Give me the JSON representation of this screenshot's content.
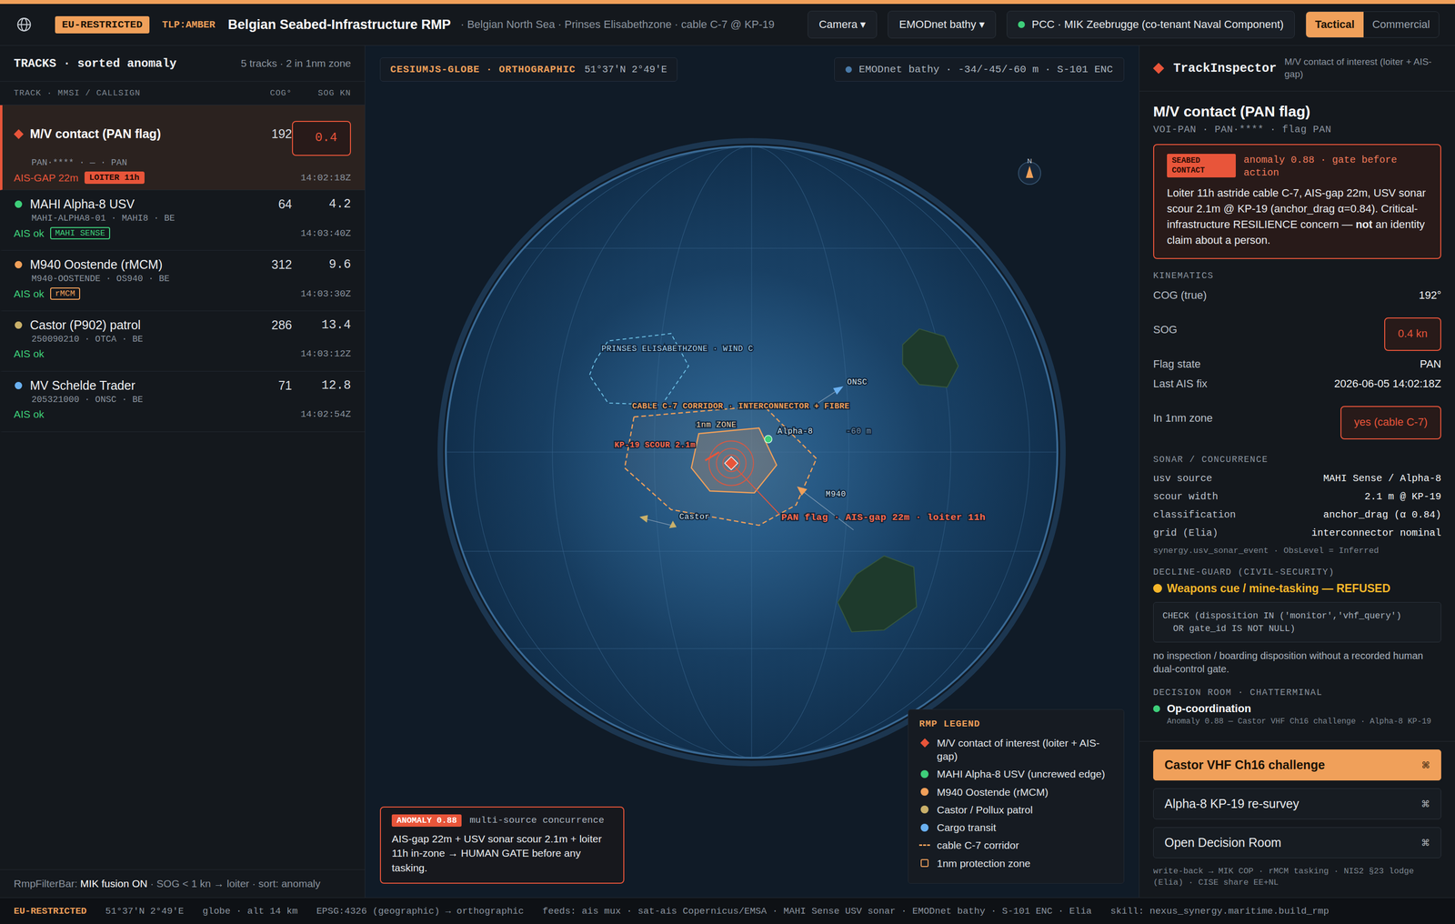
{
  "header": {
    "badge": "EU-RESTRICTED",
    "tlp": "TLP:AMBER",
    "title": "Belgian Seabed-Infrastructure RMP",
    "subtitle": "· Belgian North Sea · Prinses Elisabethzone · cable C-7 @ KP-19",
    "dropdowns": [
      "Camera ▾",
      "EMODnet bathy ▾"
    ],
    "pcc": "PCC · MIK Zeebrugge (co-tenant Naval Component)",
    "modes": [
      {
        "label": "Tactical",
        "selected": true
      },
      {
        "label": "Commercial",
        "selected": false
      }
    ]
  },
  "tracks_panel": {
    "title": "TRACKS · sorted anomaly",
    "count": "5 tracks · 2 in 1nm zone",
    "columns": [
      "TRACK · MMSI / CALLSIGN",
      "COG°",
      "SOG KN"
    ],
    "rows": [
      {
        "name": "M/V contact (PAN flag)",
        "ids": "PAN·**** · — · PAN",
        "cog": "192",
        "sog": "0.4",
        "sog_alert": true,
        "status": "AIS-GAP 22m",
        "status_color": "#e8553a",
        "tag": {
          "label": "LOITER 11h",
          "color": "#e8553a",
          "kind": "solid"
        },
        "time": "14:02:18Z",
        "color": "#e8553a",
        "kind": "diamond",
        "selected": true
      },
      {
        "name": "MAHI Alpha-8 USV",
        "ids": "MAHI-ALPHA8-01 · MAHI8 · BE",
        "cog": "64",
        "sog": "4.2",
        "sog_alert": false,
        "status": "AIS ok",
        "status_color": "#3ecf7a",
        "tag": {
          "label": "MAHI SENSE",
          "color": "#3ecf7a",
          "kind": "outline"
        },
        "time": "14:03:40Z",
        "color": "#3ecf7a",
        "kind": "dot",
        "selected": false
      },
      {
        "name": "M940 Oostende (rMCM)",
        "ids": "M940-OOSTENDE · OS940 · BE",
        "cog": "312",
        "sog": "9.6",
        "sog_alert": false,
        "status": "AIS ok",
        "status_color": "#3ecf7a",
        "tag": {
          "label": "rMCM",
          "color": "#f0a05a",
          "kind": "outline"
        },
        "time": "14:03:30Z",
        "color": "#f0a05a",
        "kind": "dot",
        "selected": false
      },
      {
        "name": "Castor (P902) patrol",
        "ids": "250090210 · OTCA · BE",
        "cog": "286",
        "sog": "13.4",
        "sog_alert": false,
        "status": "AIS ok",
        "status_color": "#3ecf7a",
        "tag": null,
        "time": "14:03:12Z",
        "color": "#c9b06a",
        "kind": "dot",
        "selected": false
      },
      {
        "name": "MV Schelde Trader",
        "ids": "205321000 · ONSC · BE",
        "cog": "71",
        "sog": "12.8",
        "sog_alert": false,
        "status": "AIS ok",
        "status_color": "#3ecf7a",
        "tag": null,
        "time": "14:02:54Z",
        "color": "#6ab0f0",
        "kind": "dot",
        "selected": false
      }
    ],
    "filter": {
      "prefix": "RmpFilterBar:",
      "highlight": "MIK fusion ON",
      "suffix": "· SOG < 1 kn → loiter · sort: anomaly"
    }
  },
  "map": {
    "projection": "CESIUMJS-GLOBE · ORTHOGRAPHIC",
    "coords": "51°37′N 2°49′E",
    "layers": "EMODnet bathy · -34/-45/-60 m · S-101 ENC",
    "compass": "N",
    "labels": [
      "PRINSES ELISABETHZONE · WIND C",
      "CABLE C-7 CORRIDOR · INTERCONNECTOR + FIBRE",
      "1nm ZONE",
      "KP-19 SCOUR 2.1m",
      "Alpha-8",
      "-60 m",
      "ONSC",
      "M940",
      "Castor",
      "PAN flag · AIS-gap 22m · loiter 11h"
    ],
    "anomaly": {
      "badge": "ANOMALY 0.88",
      "title": "multi-source concurrence",
      "text": "AIS-gap 22m + USV sonar scour 2.1m + loiter 11h in-zone → HUMAN GATE before any tasking."
    },
    "legend": {
      "title": "RMP LEGEND",
      "items": [
        {
          "label": "M/V contact of interest (loiter + AIS-gap)",
          "color": "#e8553a",
          "kind": "diamond"
        },
        {
          "label": "MAHI Alpha-8 USV (uncrewed edge)",
          "color": "#3ecf7a",
          "kind": "dot"
        },
        {
          "label": "M940 Oostende (rMCM)",
          "color": "#f0a05a",
          "kind": "dot"
        },
        {
          "label": "Castor / Pollux patrol",
          "color": "#c9b06a",
          "kind": "dot"
        },
        {
          "label": "Cargo transit",
          "color": "#6ab0f0",
          "kind": "dot"
        },
        {
          "label": "cable C-7 corridor",
          "color": "#f0a05a",
          "kind": "dash"
        },
        {
          "label": "1nm protection zone",
          "color": "#f0a05a",
          "kind": "box"
        }
      ]
    }
  },
  "inspector": {
    "header": "TrackInspector",
    "header_sub": "M/V contact of interest (loiter + AIS-gap)",
    "title": "M/V contact (PAN flag)",
    "subtitle": "VOI-PAN · PAN·**** · flag PAN",
    "alert": {
      "badge": "SEABED CONTACT",
      "headline": "anomaly 0.88 · gate before action",
      "body_before": "Loiter 11h astride cable C-7, AIS-gap 22m, USV sonar scour 2.1m @ KP-19 (anchor_drag α=0.84). Critical-infrastructure RESILIENCE concern — ",
      "body_bold": "not",
      "body_after": " an identity claim about a person."
    },
    "kinematics": {
      "title": "KINEMATICS",
      "rows": [
        {
          "label": "COG (true)",
          "value": "192°",
          "alert": false
        },
        {
          "label": "SOG",
          "value": "0.4 kn",
          "alert": true
        },
        {
          "label": "Flag state",
          "value": "PAN",
          "alert": false
        },
        {
          "label": "Last AIS fix",
          "value": "2026-06-05 14:02:18Z",
          "alert": false
        },
        {
          "label": "In 1nm zone",
          "value": "yes (cable C-7)",
          "alert": true
        }
      ]
    },
    "sonar": {
      "title": "SONAR / CONCURRENCE",
      "rows": [
        {
          "label": "usv source",
          "value": "MAHI Sense / Alpha-8"
        },
        {
          "label": "scour width",
          "value": "2.1 m @ KP-19"
        },
        {
          "label": "classification",
          "value": "anchor_drag (α 0.84)"
        },
        {
          "label": "grid (Elia)",
          "value": "interconnector nominal"
        }
      ],
      "note": "synergy.usv_sonar_event · ObsLevel = Inferred"
    },
    "decline": {
      "title": "DECLINE-GUARD (CIVIL-SECURITY)",
      "refusal": "Weapons cue / mine-tasking — REFUSED",
      "code": "CHECK (disposition IN ('monitor','vhf_query')\n  OR gate_id IS NOT NULL)",
      "note": "no inspection / boarding disposition without a recorded human dual-control gate."
    },
    "decision": {
      "title": "DECISION ROOM · CHATTERMINAL",
      "channel": "Op-coordination",
      "line": "Anomaly 0.88 — Castor VHF Ch16 challenge · Alpha-8 KP-19"
    },
    "buttons": [
      {
        "label": "Castor VHF Ch16 challenge",
        "shortcut": "⌘",
        "primary": true
      },
      {
        "label": "Alpha-8 KP-19 re-survey",
        "shortcut": "⌘",
        "primary": false
      },
      {
        "label": "Open Decision Room",
        "shortcut": "⌘",
        "primary": false
      }
    ],
    "footer": "write-back → MIK COP · rMCM tasking · NIS2 §23 lodge (Elia) · CISE share EE+NL"
  },
  "status_bar": {
    "classification": "EU-RESTRICTED",
    "items": [
      "51°37′N 2°49′E",
      "globe · alt 14 km",
      "EPSG:4326 (geographic) → orthographic",
      "feeds: ais mux · sat-ais Copernicus/EMSA · MAHI Sense USV sonar · EMODnet bathy · S-101 ENC · Elia",
      "skill: nexus_synergy.maritime.build_rmp"
    ]
  }
}
